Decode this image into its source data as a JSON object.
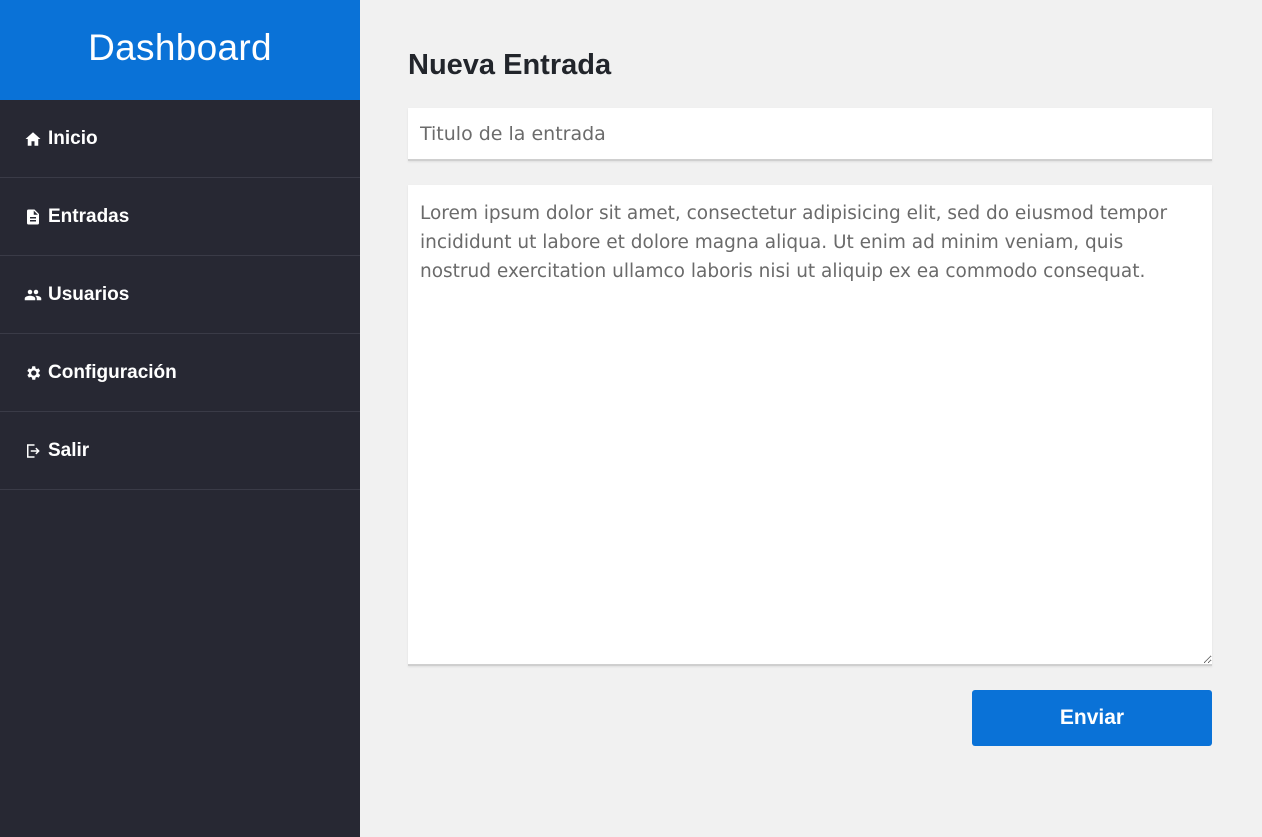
{
  "sidebar": {
    "brand": "Dashboard",
    "items": [
      {
        "label": "Inicio",
        "icon": "home-icon"
      },
      {
        "label": "Entradas",
        "icon": "document-icon"
      },
      {
        "label": "Usuarios",
        "icon": "users-icon"
      },
      {
        "label": "Configuración",
        "icon": "gear-icon"
      },
      {
        "label": "Salir",
        "icon": "logout-icon"
      }
    ]
  },
  "main": {
    "title": "Nueva Entrada",
    "title_input": {
      "placeholder": "Titulo de la entrada",
      "value": ""
    },
    "body_textarea": {
      "value": "Lorem ipsum dolor sit amet, consectetur adipisicing elit, sed do eiusmod tempor incididunt ut labore et dolore magna aliqua. Ut enim ad minim veniam, quis nostrud exercitation ullamco laboris nisi ut aliquip ex ea commodo consequat."
    },
    "submit_label": "Enviar"
  },
  "colors": {
    "brand": "#0a72d7",
    "sidebar_bg": "#272833",
    "page_bg": "#f1f1f1"
  }
}
